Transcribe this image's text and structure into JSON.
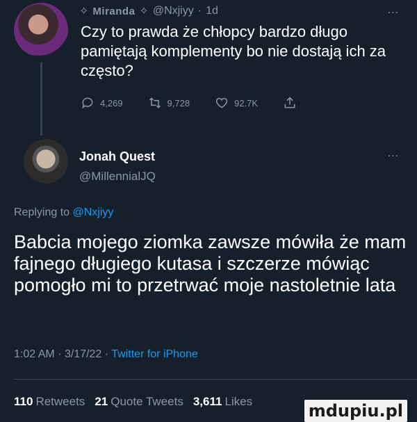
{
  "parent": {
    "name": "Miranda",
    "handle": "@Nxjiyy",
    "time": "1d",
    "more": "...",
    "text": "Czy to prawda że chłopcy bardzo długo pamiętają komplementy bo nie dostają ich za często?",
    "replies": "4,269",
    "retweets": "9,728",
    "likes": "92.7K"
  },
  "main": {
    "name": "Jonah Quest",
    "handle": "@MillennialJQ",
    "more": "...",
    "reply_prefix": "Replying to",
    "reply_to": "@Nxjiyy",
    "text": "Babcia mojego ziomka zawsze mówiła że mam fajnego długiego kutasa i szczerze mówiąc pomogło mi to przetrwać moje nastoletnie lata",
    "time": "1:02 AM",
    "date": "3/17/22",
    "source": "Twitter for iPhone"
  },
  "stats": {
    "retweets_count": "110",
    "retweets_label": "Retweets",
    "quotes_count": "21",
    "quotes_label": "Quote Tweets",
    "likes_count": "3,611",
    "likes_label": "Likes"
  },
  "watermark": "mdupiu.pl",
  "colors": {
    "background": "#15202b",
    "muted": "#8b98a5",
    "link": "#1d9bf0"
  }
}
